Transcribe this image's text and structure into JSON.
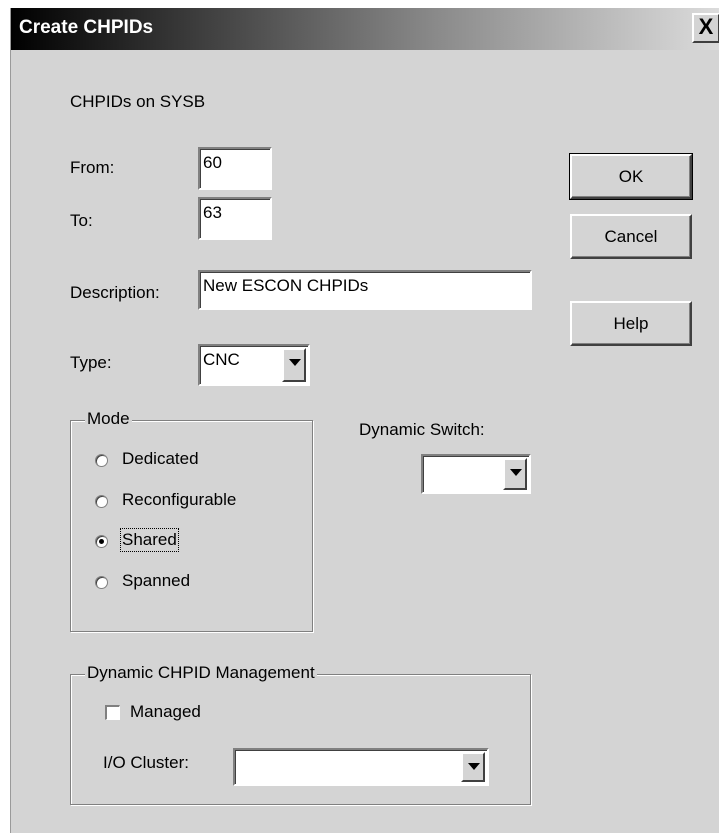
{
  "window": {
    "title": "Create CHPIDs",
    "close_label": "X"
  },
  "form": {
    "heading": "CHPIDs on SYSB",
    "from_label": "From:",
    "from_value": "60",
    "to_label": "To:",
    "to_value": "63",
    "description_label": "Description:",
    "description_value": "New ESCON CHPIDs",
    "type_label": "Type:",
    "type_value": "CNC",
    "dynamic_switch_label": "Dynamic Switch:",
    "dynamic_switch_value": ""
  },
  "buttons": {
    "ok": "OK",
    "cancel": "Cancel",
    "help": "Help"
  },
  "mode": {
    "legend": "Mode",
    "options": [
      {
        "label": "Dedicated",
        "selected": false
      },
      {
        "label": "Reconfigurable",
        "selected": false
      },
      {
        "label": "Shared",
        "selected": true
      },
      {
        "label": "Spanned",
        "selected": false
      }
    ]
  },
  "dcm": {
    "legend": "Dynamic CHPID Management",
    "managed_label": "Managed",
    "managed_checked": false,
    "io_cluster_label": "I/O Cluster:",
    "io_cluster_value": ""
  }
}
